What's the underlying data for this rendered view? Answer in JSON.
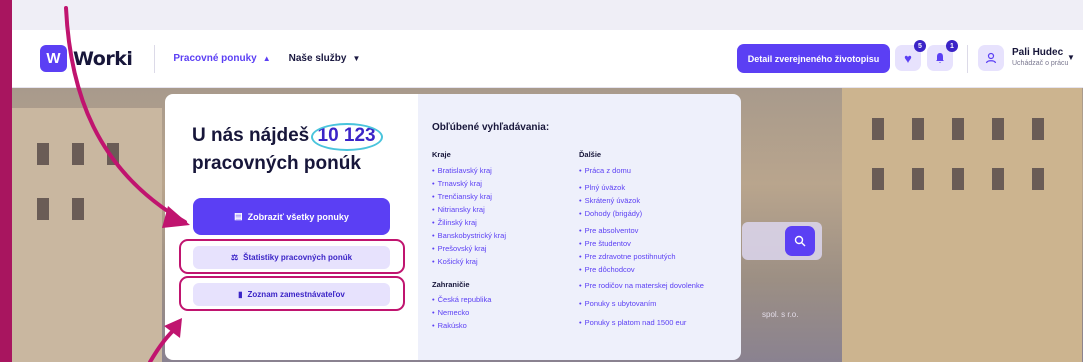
{
  "header": {
    "logo_text": "Worki",
    "nav": [
      {
        "label": "Pracovné ponuky",
        "active": true
      },
      {
        "label": "Naše služby",
        "active": false
      }
    ],
    "cv_button": "Detail zverejneného životopisu",
    "favorites_badge": "5",
    "notifications_badge": "1",
    "user_name": "Pali Hudec",
    "user_role": "Uchádzač o prácu"
  },
  "hero": {
    "copyright": "spol. s r.o."
  },
  "dropdown": {
    "headline_before": "U nás nájdeš",
    "job_count": "10 123",
    "headline_after": "pracovných ponúk",
    "primary_button": "Zobraziť všetky ponuky",
    "stats_button": "Štatistiky pracovných ponúk",
    "employers_button": "Zoznam zamestnávateľov",
    "popular_title": "Obľúbené vyhľadávania:",
    "regions_title": "Kraje",
    "regions": [
      "Bratislavský kraj",
      "Trnavský kraj",
      "Trenčiansky kraj",
      "Nitriansky kraj",
      "Žilinský kraj",
      "Banskobystrický kraj",
      "Prešovský kraj",
      "Košický kraj"
    ],
    "abroad_title": "Zahraničie",
    "abroad": [
      "Česká republika",
      "Nemecko",
      "Rakúsko"
    ],
    "other_title": "Ďalšie",
    "other": [
      "Práca z domu",
      "Plný úväzok",
      "Skrátený úväzok",
      "Dohody (brigády)",
      "Pre absolventov",
      "Pre študentov",
      "Pre zdravotne postihnutých",
      "Pre dôchodcov",
      "Pre rodičov na materskej dovolenke",
      "Ponuky s ubytovaním",
      "Ponuky s platom nad 1500 eur"
    ]
  },
  "colors": {
    "brand": "#5b3ff4",
    "annotation": "#c0146f",
    "highlight_ring": "#49c4dc"
  }
}
